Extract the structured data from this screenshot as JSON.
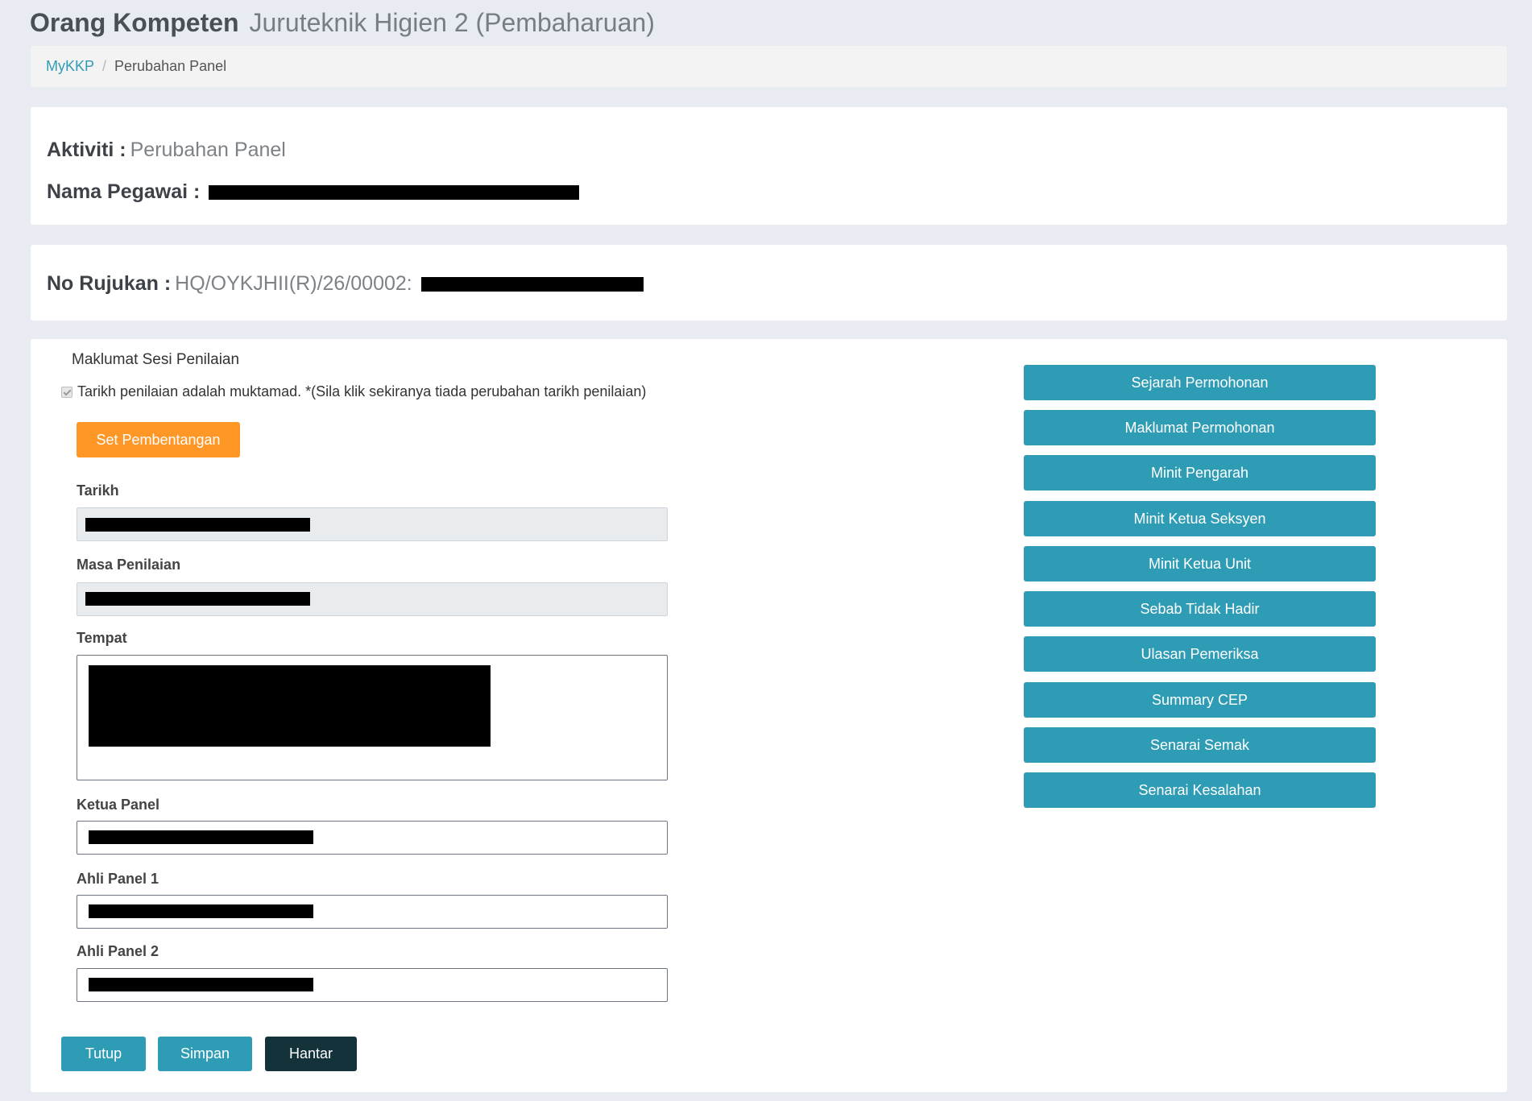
{
  "header": {
    "title_main": "Orang Kompeten",
    "title_sub": "Juruteknik Higien 2 (Pembaharuan)"
  },
  "breadcrumb": {
    "home": "MyKKP",
    "separator": "/",
    "current": "Perubahan Panel"
  },
  "info": {
    "aktiviti_label": "Aktiviti :",
    "aktiviti_value": "Perubahan Panel",
    "nama_label": "Nama Pegawai :",
    "rujukan_label": "No Rujukan :",
    "rujukan_value": "HQ/OYKJHII(R)/26/00002:"
  },
  "form": {
    "section_title": "Maklumat Sesi Penilaian",
    "checkbox_label": "Tarikh penilaian adalah muktamad. *(Sila klik sekiranya tiada perubahan tarikh penilaian)",
    "checkbox_checked": true,
    "set_button": "Set Pembentangan",
    "tarikh_label": "Tarikh",
    "masa_label": "Masa Penilaian",
    "tempat_label": "Tempat",
    "ketua_label": "Ketua Panel",
    "ahli1_label": "Ahli Panel 1",
    "ahli2_label": "Ahli Panel 2"
  },
  "side_buttons": [
    "Sejarah Permohonan",
    "Maklumat Permohonan",
    "Minit Pengarah",
    "Minit Ketua Seksyen",
    "Minit Ketua Unit",
    "Sebab Tidak Hadir",
    "Ulasan Pemeriksa",
    "Summary CEP",
    "Senarai Semak",
    "Senarai Kesalahan"
  ],
  "actions": {
    "tutup": "Tutup",
    "simpan": "Simpan",
    "hantar": "Hantar"
  },
  "colors": {
    "background": "#e9ebf3",
    "primary": "#2f9cb5",
    "orange": "#ff9726",
    "dark": "#14323a",
    "link": "#2f9cb3"
  }
}
